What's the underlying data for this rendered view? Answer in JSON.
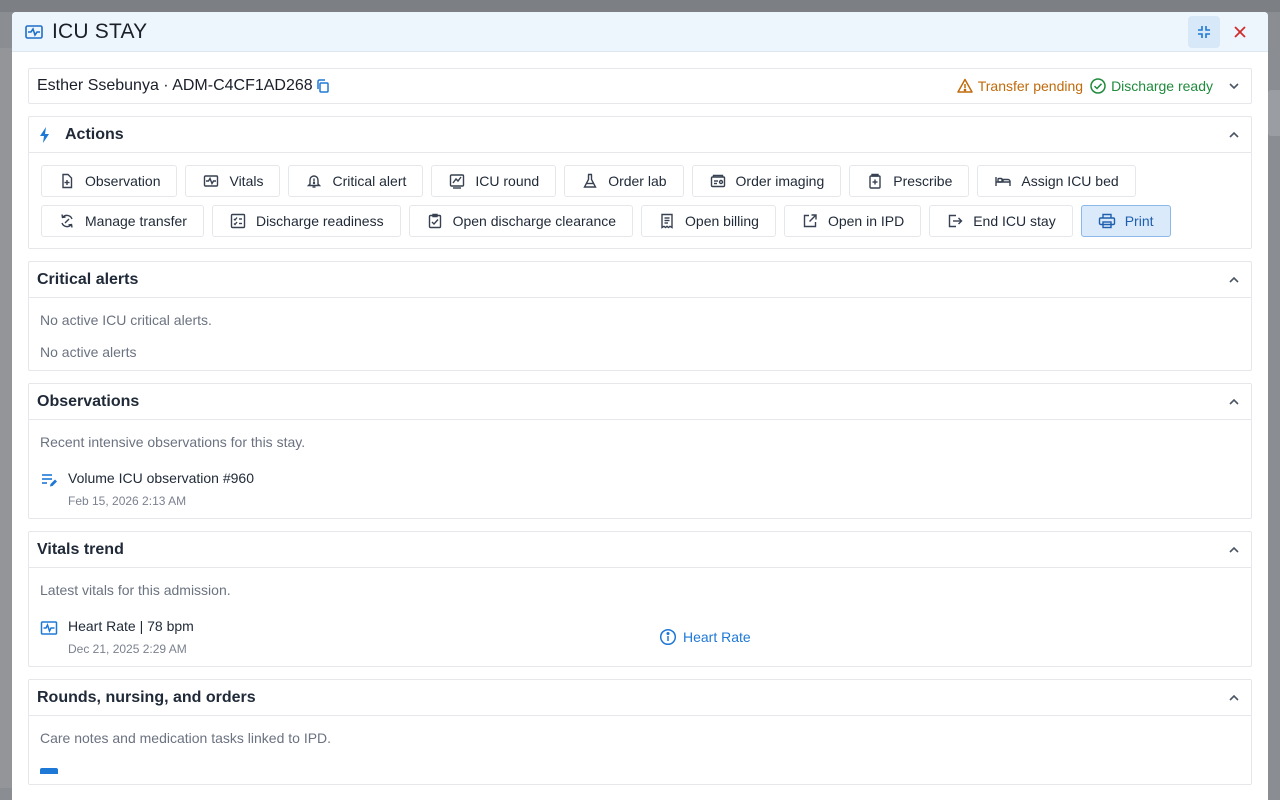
{
  "modal": {
    "title": "ICU STAY",
    "collapse_label": "Collapse",
    "close_label": "Close"
  },
  "patient": {
    "label": "Esther Ssebunya · ADM-C4CF1AD268",
    "badges": [
      {
        "label": "Transfer pending",
        "color": "#c06a0a",
        "icon": "warning-triangle-icon"
      },
      {
        "label": "Discharge ready",
        "color": "#1f8a3c",
        "icon": "check-circle-icon"
      }
    ]
  },
  "actions": {
    "title": "Actions",
    "buttons": [
      {
        "label": "Observation",
        "icon": "file-plus-icon"
      },
      {
        "label": "Vitals",
        "icon": "heart-monitor-icon"
      },
      {
        "label": "Critical alert",
        "icon": "alert-bell-icon"
      },
      {
        "label": "ICU round",
        "icon": "round-chart-icon"
      },
      {
        "label": "Order lab",
        "icon": "flask-icon"
      },
      {
        "label": "Order imaging",
        "icon": "imaging-icon"
      },
      {
        "label": "Prescribe",
        "icon": "prescription-icon"
      },
      {
        "label": "Assign ICU bed",
        "icon": "bed-icon"
      },
      {
        "label": "Manage transfer",
        "icon": "transfer-icon"
      },
      {
        "label": "Discharge readiness",
        "icon": "checklist-icon"
      },
      {
        "label": "Open discharge clearance",
        "icon": "clipboard-check-icon"
      },
      {
        "label": "Open billing",
        "icon": "billing-icon"
      },
      {
        "label": "Open in IPD",
        "icon": "external-link-icon"
      },
      {
        "label": "End ICU stay",
        "icon": "exit-icon"
      },
      {
        "label": "Print",
        "icon": "printer-icon"
      }
    ]
  },
  "critical_alerts": {
    "title": "Critical alerts",
    "line1": "No active ICU critical alerts.",
    "line2": "No active alerts"
  },
  "observations": {
    "title": "Observations",
    "description": "Recent intensive observations for this stay.",
    "items": [
      {
        "title": "Volume ICU observation #960",
        "time": "Feb 15, 2026 2:13 AM"
      }
    ]
  },
  "vitals": {
    "title": "Vitals trend",
    "description": "Latest vitals for this admission.",
    "items": [
      {
        "title": "Heart Rate | 78 bpm",
        "time": "Dec 21, 2025 2:29 AM"
      }
    ],
    "link_label": "Heart Rate"
  },
  "rounds": {
    "title": "Rounds, nursing, and orders",
    "description": "Care notes and medication tasks linked to IPD."
  }
}
